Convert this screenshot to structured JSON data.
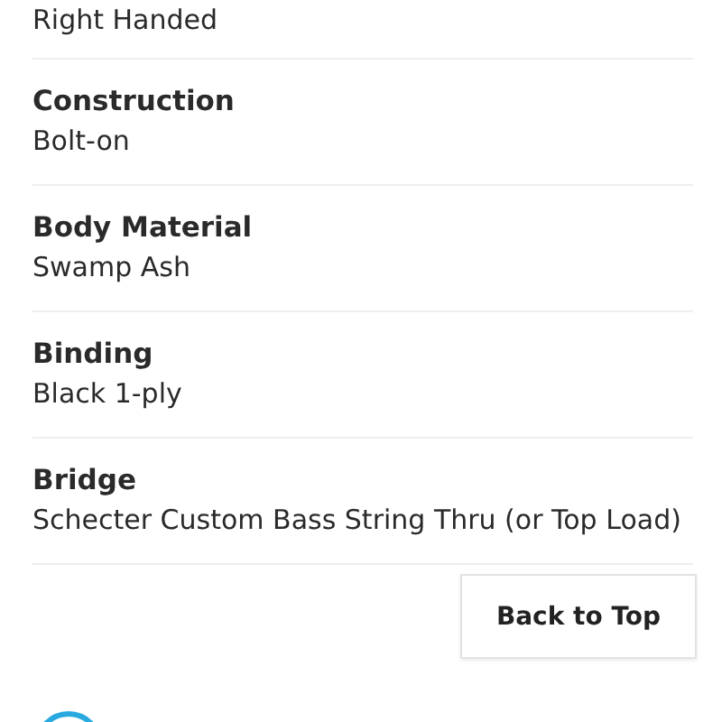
{
  "specs": [
    {
      "value": "Right Handed"
    },
    {
      "label": "Construction",
      "value": "Bolt-on"
    },
    {
      "label": "Body Material",
      "value": "Swamp Ash"
    },
    {
      "label": "Binding",
      "value": "Black 1-ply"
    },
    {
      "label": "Bridge",
      "value": "Schecter Custom Bass String Thru (or Top Load)"
    }
  ],
  "back_to_top": "Back to Top"
}
